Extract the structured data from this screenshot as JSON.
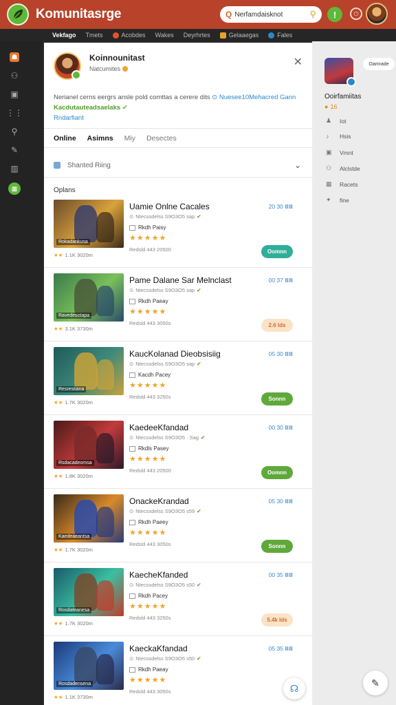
{
  "app": {
    "title": "Komunitasrge",
    "search_value": "Nerfamdaisknot",
    "icons": [
      "leaf-icon",
      "search-icon",
      "power-icon"
    ]
  },
  "nav": [
    {
      "label": "Vekfago",
      "active": true,
      "dot": ""
    },
    {
      "label": "Tmets",
      "active": false,
      "dot": ""
    },
    {
      "label": "Acobdes",
      "active": false,
      "dot": "#e8522a"
    },
    {
      "label": "Wakes",
      "active": false,
      "dot": ""
    },
    {
      "label": "Deyrhrtes",
      "active": false,
      "dot": ""
    },
    {
      "label": "Gelaaegas",
      "active": false,
      "dot": "#e3a428"
    },
    {
      "label": "Fales",
      "active": false,
      "dot": "#2a8ac9"
    }
  ],
  "profile": {
    "name": "Koinnounitast",
    "subtitle": "Natcumites",
    "bio_text": "Nerianel cerns eergrs ansle pold comttas a cerere dits",
    "bio_link": "Nuesee10Mehacred Gann",
    "bio_tag": "Kacdutauteadsaelaks",
    "bio_more": "Rndarfiant"
  },
  "tabs": [
    {
      "label": "Online",
      "active": true
    },
    {
      "label": "Asimns",
      "active": true
    },
    {
      "label": "Miy",
      "active": false
    },
    {
      "label": "Desectes",
      "active": false
    }
  ],
  "filter": {
    "label": "Shanted Riing"
  },
  "list_heading": "Oplans",
  "games": [
    {
      "title": "Uamie Onlne Cacales",
      "line1": "Ntecssdelss S9O3O5 sap",
      "player": "Rkdh Paisy",
      "line3": "Redsld 443 20500",
      "time": "20 30 ⅢⅢ",
      "button": "Oomnn",
      "button_color": "#2fae9a",
      "button_text": "#ffffff",
      "thumb_label": "Rokadankusa",
      "meta": "1.1K 3020m",
      "stars_small": "★★",
      "stars": "★★★★★",
      "bg": [
        "#6a4a2a",
        "#d9a23c",
        "#3a2a1a"
      ],
      "fig": "#3a3f6a"
    },
    {
      "title": "Pame Dalane Sar Melnclast",
      "line1": "Ntecssdelss S9O3O5 sap",
      "player": "Rkdh Paeay",
      "line3": "Redsld 443 3050s",
      "time": "00 37 ⅢⅢ",
      "button": "2.6 Ids",
      "button_color": "#fbe3c8",
      "button_text": "#d9692a",
      "thumb_label": "Ravedesotapa",
      "meta": "3.1K 3730m",
      "stars_small": "★★",
      "stars": "★★★★★",
      "bg": [
        "#3a7a4a",
        "#7ac05a",
        "#2a4a6a"
      ],
      "fig": "#4a5a3a"
    },
    {
      "title": "KaucKolanad Dieobsisiig",
      "line1": "Ntecssdelss S9O3O5 sap",
      "player": "Kacdh Pacey",
      "line3": "Redsld 443 3250s",
      "time": "05 30 ⅢⅢ",
      "button": "Sonnn",
      "button_color": "#5fa83a",
      "button_text": "#ffffff",
      "thumb_label": "Resrestiana",
      "meta": "1.7K 3020m",
      "stars_small": "★★",
      "stars": "★★★★★",
      "bg": [
        "#1f5a5a",
        "#3f8a7a",
        "#c9a23a"
      ],
      "fig": "#c9a23a"
    },
    {
      "title": "KaedeeKfandad",
      "line1": "Ntecssdelss S9O3O5 · Sag",
      "player": "Rkdls Pasey",
      "line3": "Redsld 443 20500",
      "time": "00 30 ⅢⅢ",
      "button": "Oomnn",
      "button_color": "#5fa83a",
      "button_text": "#ffffff",
      "thumb_label": "Rsdacadeomsa",
      "meta": "1.8K 3020m",
      "stars_small": "★★",
      "stars": "★★★★★",
      "bg": [
        "#4a1a1a",
        "#c23a3a",
        "#2a1a2a"
      ],
      "fig": "#7a2a2a"
    },
    {
      "title": "OnackeKrandad",
      "line1": "Ntecssdelss S9O3O5 s59",
      "player": "Rkdh Paeey",
      "line3": "Redsld 443 3050s",
      "time": "05 30 ⅢⅢ",
      "button": "Sonnn",
      "button_color": "#5fa83a",
      "button_text": "#ffffff",
      "thumb_label": "Kaedeaeantsa",
      "meta": "1.7K 3020m",
      "stars_small": "★★",
      "stars": "★★★★★",
      "bg": [
        "#3a2a1a",
        "#d98a2a",
        "#2a3a7a"
      ],
      "fig": "#2a4aaa"
    },
    {
      "title": "KaecheKfanded",
      "line1": "Ntecssdelss S9O3O5 s50",
      "player": "Rkdh Pacey",
      "line3": "Redsld 443 3250s",
      "time": "00 35 ⅢⅢ",
      "button": "5.4k Ids",
      "button_color": "#fbe3c8",
      "button_text": "#d9692a",
      "thumb_label": "Rosdateanesa",
      "meta": "1.7K 3020m",
      "stars_small": "★★",
      "stars": "★★★★★",
      "bg": [
        "#1a5a6a",
        "#3ac0a0",
        "#c23a2a"
      ],
      "fig": "#7a4a2a"
    },
    {
      "title": "KaeckaKfandad",
      "line1": "Ntecssdelss S9O3O5 s50",
      "player": "Rkdh Paeay",
      "line3": "Redsld 443 3050s",
      "time": "05 35 ⅢⅢ",
      "button": "",
      "button_color": "#ffffff",
      "button_text": "#ffffff",
      "thumb_label": "Rosdadensena",
      "meta": "1.1K 3730m",
      "stars_small": "★★",
      "stars": "★★★★★",
      "bg": [
        "#1a3a7a",
        "#4a8ad9",
        "#2a2a4a"
      ],
      "fig": "#3a4a6a"
    }
  ],
  "right_panel": {
    "pill": "Oamrade",
    "name": "Ooirfamiitas",
    "points": "16",
    "items": [
      {
        "icon": "person-icon",
        "glyph": "♟",
        "label": "Iot"
      },
      {
        "icon": "music-icon",
        "glyph": "♪",
        "label": "Hsis"
      },
      {
        "icon": "box-icon",
        "glyph": "▣",
        "label": "Vmnt"
      },
      {
        "icon": "gamepad-icon",
        "glyph": "⚇",
        "label": "Alclstde"
      },
      {
        "icon": "grid-icon",
        "glyph": "▦",
        "label": "Racets"
      },
      {
        "icon": "puzzle-icon",
        "glyph": "✦",
        "label": "fine"
      }
    ]
  },
  "colors": {
    "header": "#b8432a",
    "accent_green": "#5fb83a",
    "accent_blue": "#2a8ac9",
    "star": "#f2a32a"
  }
}
